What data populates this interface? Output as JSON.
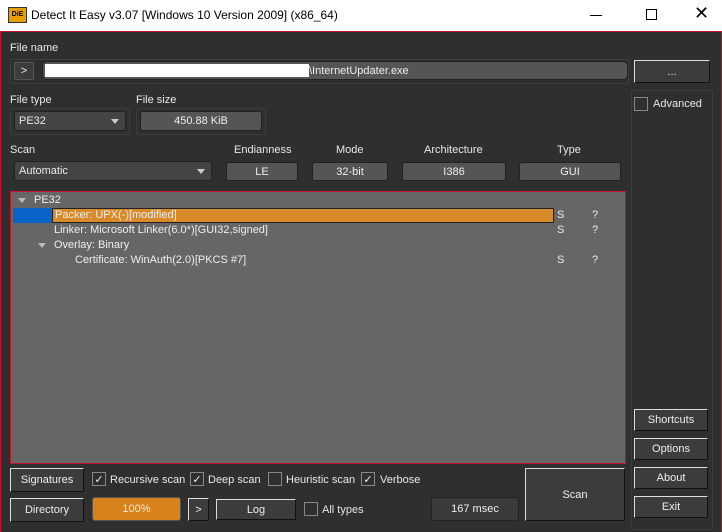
{
  "window": {
    "title": "Detect It Easy v3.07 [Windows 10 Version 2009] (x86_64)",
    "app_icon_text": "DiE"
  },
  "file": {
    "label": "File name",
    "path_suffix": "\\InternetUpdater.exe",
    "go_label": ">",
    "browse_label": "..."
  },
  "file_type": {
    "label": "File type",
    "value": "PE32"
  },
  "file_size": {
    "label": "File size",
    "value": "450.88 KiB"
  },
  "advanced": {
    "label": "Advanced",
    "checked": false
  },
  "scan": {
    "label": "Scan",
    "value": "Automatic"
  },
  "info": {
    "endianness_label": "Endianness",
    "endianness": "LE",
    "mode_label": "Mode",
    "mode": "32-bit",
    "arch_label": "Architecture",
    "arch": "I386",
    "type_label": "Type",
    "type": "GUI"
  },
  "tree": {
    "root": "PE32",
    "items": [
      {
        "text": "Packer: UPX(-)[modified]",
        "s": "S",
        "q": "?"
      },
      {
        "text": "Linker: Microsoft Linker(6.0*)[GUI32,signed]",
        "s": "S",
        "q": "?"
      },
      {
        "text": "Overlay: Binary"
      },
      {
        "text": "Certificate: WinAuth(2.0)[PKCS #7]",
        "s": "S",
        "q": "?"
      }
    ]
  },
  "options": {
    "signatures": "Signatures",
    "recursive": "Recursive scan",
    "deep": "Deep scan",
    "heuristic": "Heuristic scan",
    "verbose": "Verbose",
    "directory": "Directory",
    "progress": "100%",
    "progress_value": 100,
    "next": ">",
    "log": "Log",
    "all_types": "All types",
    "time": "167 msec",
    "scan": "Scan",
    "check": "✓"
  },
  "side": {
    "shortcuts": "Shortcuts",
    "options": "Options",
    "about": "About",
    "exit": "Exit"
  },
  "colors": {
    "accent": "#d98a2a",
    "border": "#c8102e",
    "selection": "#0a64c8"
  }
}
